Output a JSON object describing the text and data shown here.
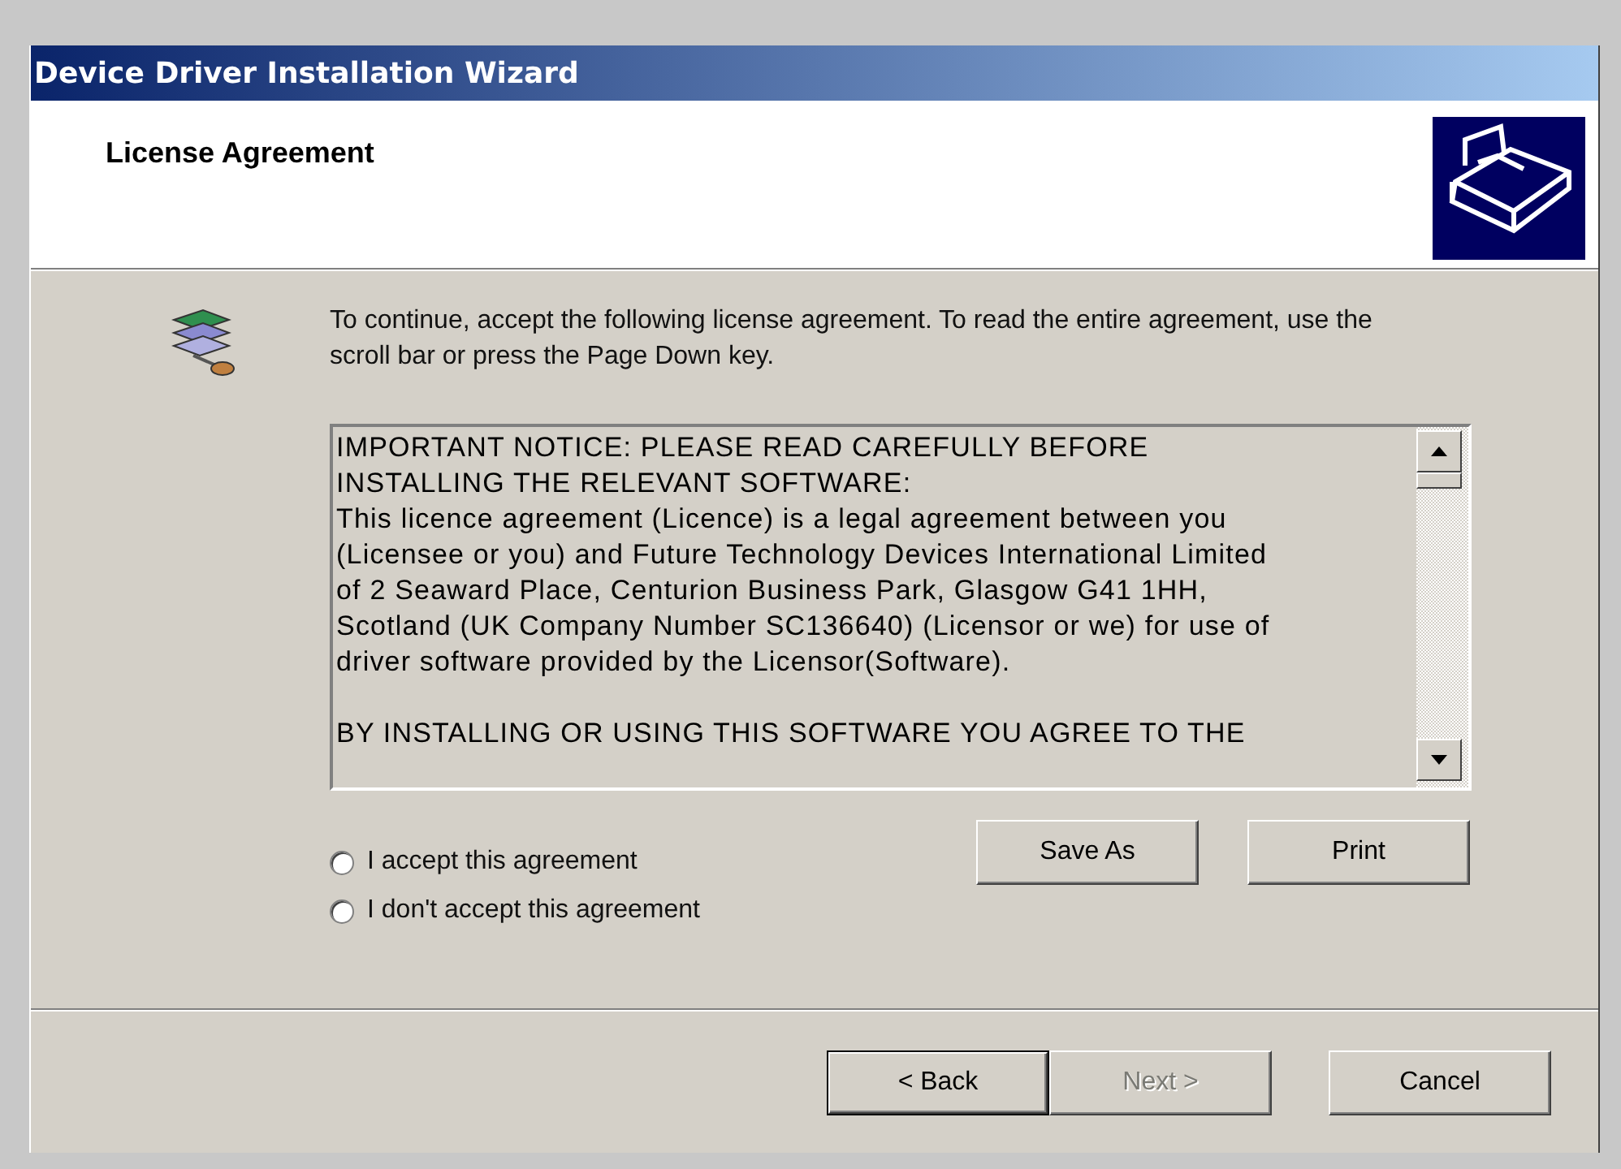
{
  "window": {
    "title": "Device Driver Installation Wizard"
  },
  "header": {
    "title": "License Agreement"
  },
  "intro": "To continue, accept the following license agreement. To read the entire agreement, use the scroll bar or press the Page Down key.",
  "license": {
    "paragraphs": [
      [
        "IMPORTANT NOTICE: PLEASE READ CAREFULLY BEFORE",
        "INSTALLING THE RELEVANT SOFTWARE:",
        "This licence agreement (Licence) is a legal agreement between you",
        "(Licensee or you) and Future Technology Devices International Limited",
        "of 2 Seaward Place, Centurion Business Park, Glasgow G41 1HH,",
        "Scotland (UK Company Number SC136640) (Licensor or we) for use of",
        "driver software provided by the Licensor(Software)."
      ],
      [
        "BY INSTALLING OR USING THIS SOFTWARE YOU AGREE TO THE"
      ]
    ]
  },
  "choices": [
    {
      "label": "I accept this agreement",
      "selected": false
    },
    {
      "label": "I don't accept this agreement",
      "selected": false
    }
  ],
  "license_buttons": [
    {
      "label": "Save As",
      "disabled": false
    },
    {
      "label": "Print",
      "disabled": false
    }
  ],
  "nav_buttons": [
    {
      "label": "< Back",
      "disabled": false,
      "default": true
    },
    {
      "label": "Next >",
      "disabled": true,
      "default": false
    },
    {
      "label": "Cancel",
      "disabled": false,
      "default": false
    }
  ]
}
